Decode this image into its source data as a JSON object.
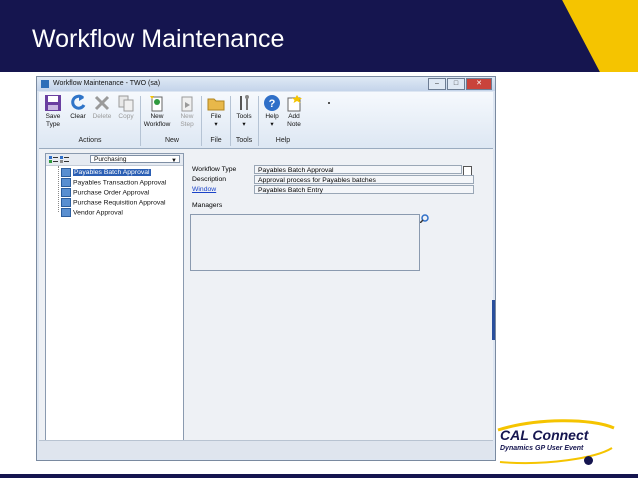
{
  "slide": {
    "title": "Workflow Maintenance"
  },
  "window": {
    "title": "Workflow Maintenance  -  TWO (sa)"
  },
  "ribbon": {
    "save": "Save\nType",
    "clear": "Clear",
    "delete": "Delete",
    "copy": "Copy",
    "new_workflow": "New\nWorkflow",
    "new_step": "New\nStep",
    "file": "File",
    "tools": "Tools",
    "help": "Help",
    "add_note": "Add\nNote",
    "groups": {
      "actions": "Actions",
      "new": "New",
      "file": "File",
      "tools": "Tools",
      "help": "Help"
    }
  },
  "tree": {
    "combo_value": "Purchasing",
    "items": [
      "Payables Batch Approval",
      "Payables Transaction Approval",
      "Purchase Order Approval",
      "Purchase Requisition Approval",
      "Vendor Approval"
    ]
  },
  "form": {
    "workflow_type_label": "Workflow Type",
    "workflow_type_value": "Payables Batch Approval",
    "description_label": "Description",
    "description_value": "Approval process for Payables batches",
    "window_label": "Window",
    "window_value": "Payables Batch Entry",
    "managers_label": "Managers"
  },
  "logo": {
    "title": "CAL Connect",
    "subtitle": "Dynamics GP User Event"
  },
  "colors": {
    "header": "#15154f",
    "accent": "#f5c400",
    "selection": "#2b5fb4"
  }
}
